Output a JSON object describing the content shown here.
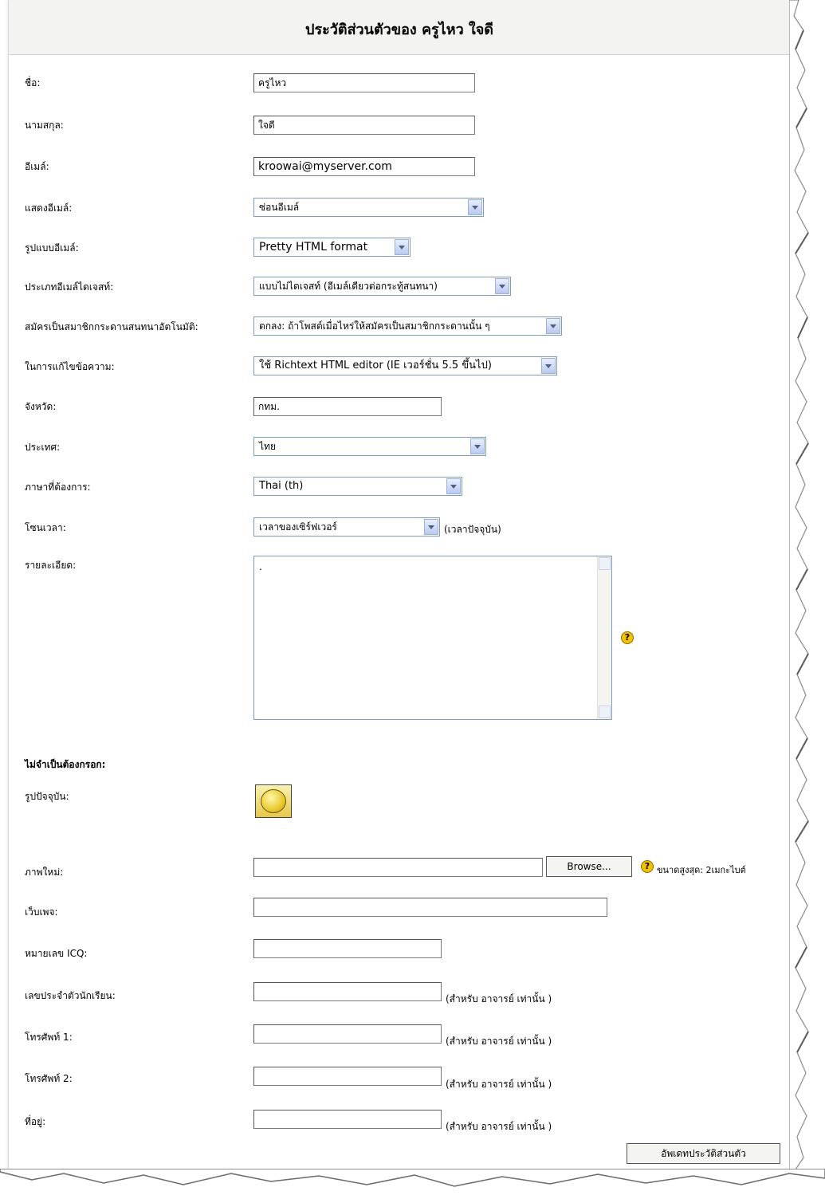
{
  "title": "ประวัติส่วนตัวของ ครูไหว ใจดี",
  "fields": {
    "firstname": {
      "label": "ชื่อ:",
      "value": "ครูไหว"
    },
    "lastname": {
      "label": "นามสกุล:",
      "value": "ใจดี"
    },
    "email": {
      "label": "อีเมล์:",
      "value": "kroowai@myserver.com"
    },
    "email_display": {
      "label": "แสดงอีเมล์:",
      "value": "ซ่อนอีเมล์"
    },
    "email_format": {
      "label": "รูปแบบอีเมล์:",
      "value": "Pretty HTML format"
    },
    "email_digest": {
      "label": "ประเภทอีเมล์ไดเจสท์:",
      "value": "แบบไม่ไดเจสท์ (อีเมล์เดียวต่อกระทู้สนทนา)"
    },
    "auto_subscribe": {
      "label": "สมัครเป็นสมาชิกกระดานสนทนาอัตโนมัติ:",
      "value": "ตกลง: ถ้าโพสต์เมื่อไหร่ให้สมัครเป็นสมาชิกกระดานนั้น ๆ"
    },
    "editor": {
      "label": "ในการแก้ไขข้อความ:",
      "value": "ใช้ Richtext HTML editor (IE เวอร์ชั่น 5.5 ขึ้นไป)"
    },
    "city": {
      "label": "จังหวัด:",
      "value": "กทม."
    },
    "country": {
      "label": "ประเทศ:",
      "value": "ไทย"
    },
    "language": {
      "label": "ภาษาที่ต้องการ:",
      "value": "Thai (th)"
    },
    "timezone": {
      "label": "โซนเวลา:",
      "value": "เวลาของเซิร์ฟเวอร์",
      "note": "(เวลาปัจจุบัน)"
    },
    "description": {
      "label": "รายละเอียด:",
      "value": "."
    }
  },
  "optional": {
    "heading": "ไม่จำเป็นต้องกรอก:",
    "current_picture_label": "รูปปัจจุบัน:",
    "new_picture_label": "ภาพใหม่:",
    "browse_label": "Browse...",
    "max_size_note": "ขนาดสูงสุด: 2เมกะไบต์",
    "webpage_label": "เว็บเพจ:",
    "icq_label": "หมายเลข ICQ:",
    "idnumber_label": "เลขประจำตัวนักเรียน:",
    "phone1_label": "โทรศัพท์ 1:",
    "phone2_label": "โทรศัพท์ 2:",
    "address_label": "ที่อยู่:",
    "teacher_only_note": "(สำหรับ อาจารย์ เท่านั้น )"
  },
  "submit_label": "อัพเดทประวัติส่วนตัว",
  "icons": {
    "help": "help-icon",
    "avatar": "smiley-avatar"
  },
  "colors": {
    "titlebar": "#f3f3f1",
    "field_border": "#7f9db9",
    "help": "#f2c200"
  }
}
